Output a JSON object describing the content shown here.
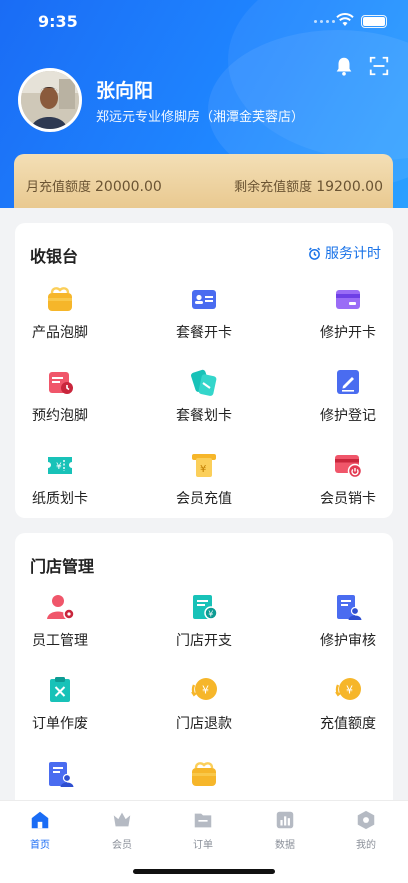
{
  "status_bar": {
    "time": "9:35"
  },
  "header": {
    "user_name": "张向阳",
    "store_name": "郑远元专业修脚房（湘潭金芙蓉店）",
    "icons": [
      "bell-icon",
      "scan-icon"
    ]
  },
  "quota": {
    "monthly_label": "月充值额度",
    "monthly_value": "20000.00",
    "remaining_label": "剩余充值额度",
    "remaining_value": "19200.00"
  },
  "cashier": {
    "title": "收银台",
    "action_label": "服务计时",
    "items": [
      {
        "label": "产品泡脚",
        "icon": "foot-bath-icon",
        "color": "#f6b62a"
      },
      {
        "label": "套餐开卡",
        "icon": "card-icon",
        "color": "#4a6cf0"
      },
      {
        "label": "修护开卡",
        "icon": "credit-card-icon",
        "color": "#8a5cf0"
      },
      {
        "label": "预约泡脚",
        "icon": "appointment-icon",
        "color": "#f0566a"
      },
      {
        "label": "套餐划卡",
        "icon": "swipe-card-icon",
        "color": "#18c2b8"
      },
      {
        "label": "修护登记",
        "icon": "edit-icon",
        "color": "#4a6cf0"
      },
      {
        "label": "纸质划卡",
        "icon": "paper-ticket-icon",
        "color": "#18c2b8"
      },
      {
        "label": "会员充值",
        "icon": "recharge-icon",
        "color": "#f6b62a"
      },
      {
        "label": "会员销卡",
        "icon": "cancel-card-icon",
        "color": "#f0566a"
      }
    ]
  },
  "store": {
    "title": "门店管理",
    "items": [
      {
        "label": "员工管理",
        "icon": "staff-icon",
        "color": "#f0566a"
      },
      {
        "label": "门店开支",
        "icon": "expense-icon",
        "color": "#18c2b8"
      },
      {
        "label": "修护审核",
        "icon": "audit-icon",
        "color": "#4a6cf0"
      },
      {
        "label": "订单作废",
        "icon": "void-order-icon",
        "color": "#18c2b8"
      },
      {
        "label": "门店退款",
        "icon": "refund-icon",
        "color": "#f6b62a"
      },
      {
        "label": "充值额度",
        "icon": "quota-icon",
        "color": "#f6b62a"
      },
      {
        "label": "",
        "icon": "document-user-icon",
        "color": "#4a6cf0"
      },
      {
        "label": "",
        "icon": "basket-icon",
        "color": "#f6b62a"
      }
    ]
  },
  "tabbar": {
    "tabs": [
      {
        "label": "首页",
        "icon": "home-icon",
        "active": true
      },
      {
        "label": "会员",
        "icon": "crown-icon",
        "active": false
      },
      {
        "label": "订单",
        "icon": "folder-icon",
        "active": false
      },
      {
        "label": "数据",
        "icon": "chart-icon",
        "active": false
      },
      {
        "label": "我的",
        "icon": "profile-icon",
        "active": false
      }
    ]
  }
}
